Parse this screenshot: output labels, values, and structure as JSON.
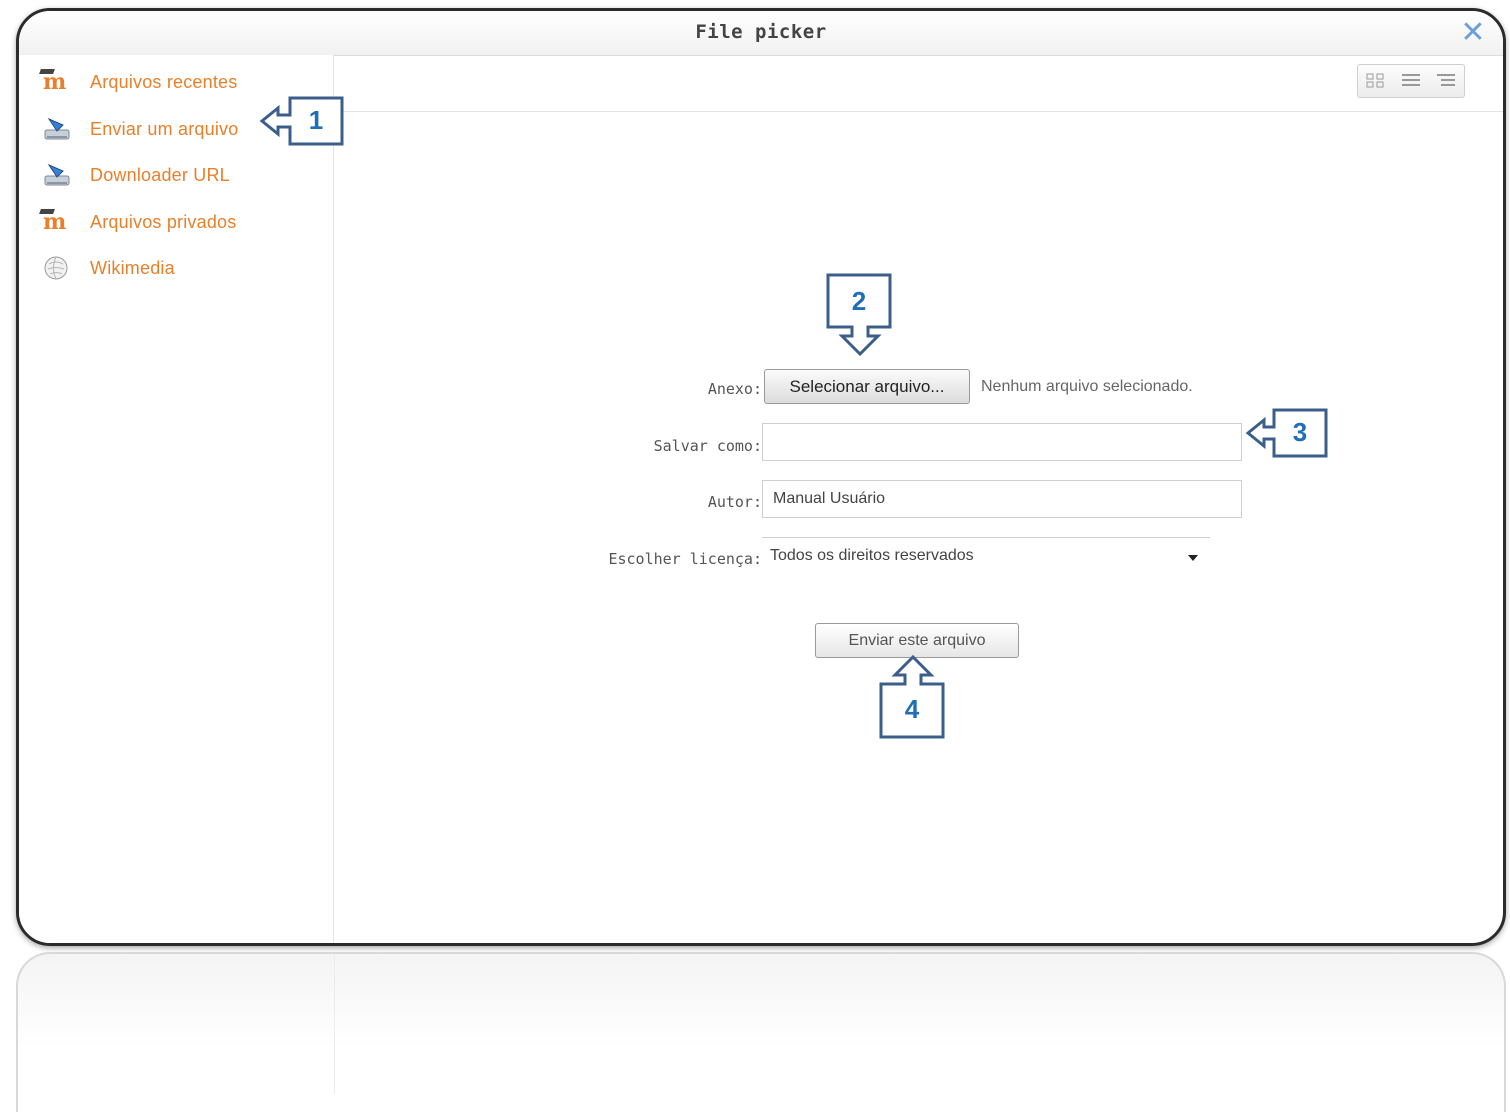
{
  "dialog": {
    "title": "File picker",
    "close_icon": "close-icon"
  },
  "sidebar": {
    "items": [
      {
        "label": "Arquivos recentes",
        "icon": "moodle-icon"
      },
      {
        "label": "Enviar um arquivo",
        "icon": "upload-icon"
      },
      {
        "label": "Downloader URL",
        "icon": "upload-icon"
      },
      {
        "label": "Arquivos privados",
        "icon": "moodle-icon"
      },
      {
        "label": "Wikimedia",
        "icon": "wikipedia-globe-icon"
      }
    ]
  },
  "toolbar": {
    "view_icons": [
      "grid-view-icon",
      "list-view-icon",
      "tree-view-icon"
    ]
  },
  "form": {
    "attachment_label": "Anexo:",
    "choose_file_button": "Selecionar arquivo...",
    "no_file_text": "Nenhum arquivo selecionado.",
    "save_as_label": "Salvar como:",
    "save_as_value": "",
    "author_label": "Autor:",
    "author_value": "Manual Usuário",
    "license_label": "Escolher licença:",
    "license_value": "Todos os direitos reservados",
    "submit_button": "Enviar este arquivo"
  },
  "callouts": [
    "1",
    "2",
    "3",
    "4"
  ],
  "colors": {
    "link_orange": "#e8802b",
    "callout_blue": "#1f6fb8",
    "callout_frame": "#3b5f8a",
    "close_blue": "#6d9fd8"
  }
}
